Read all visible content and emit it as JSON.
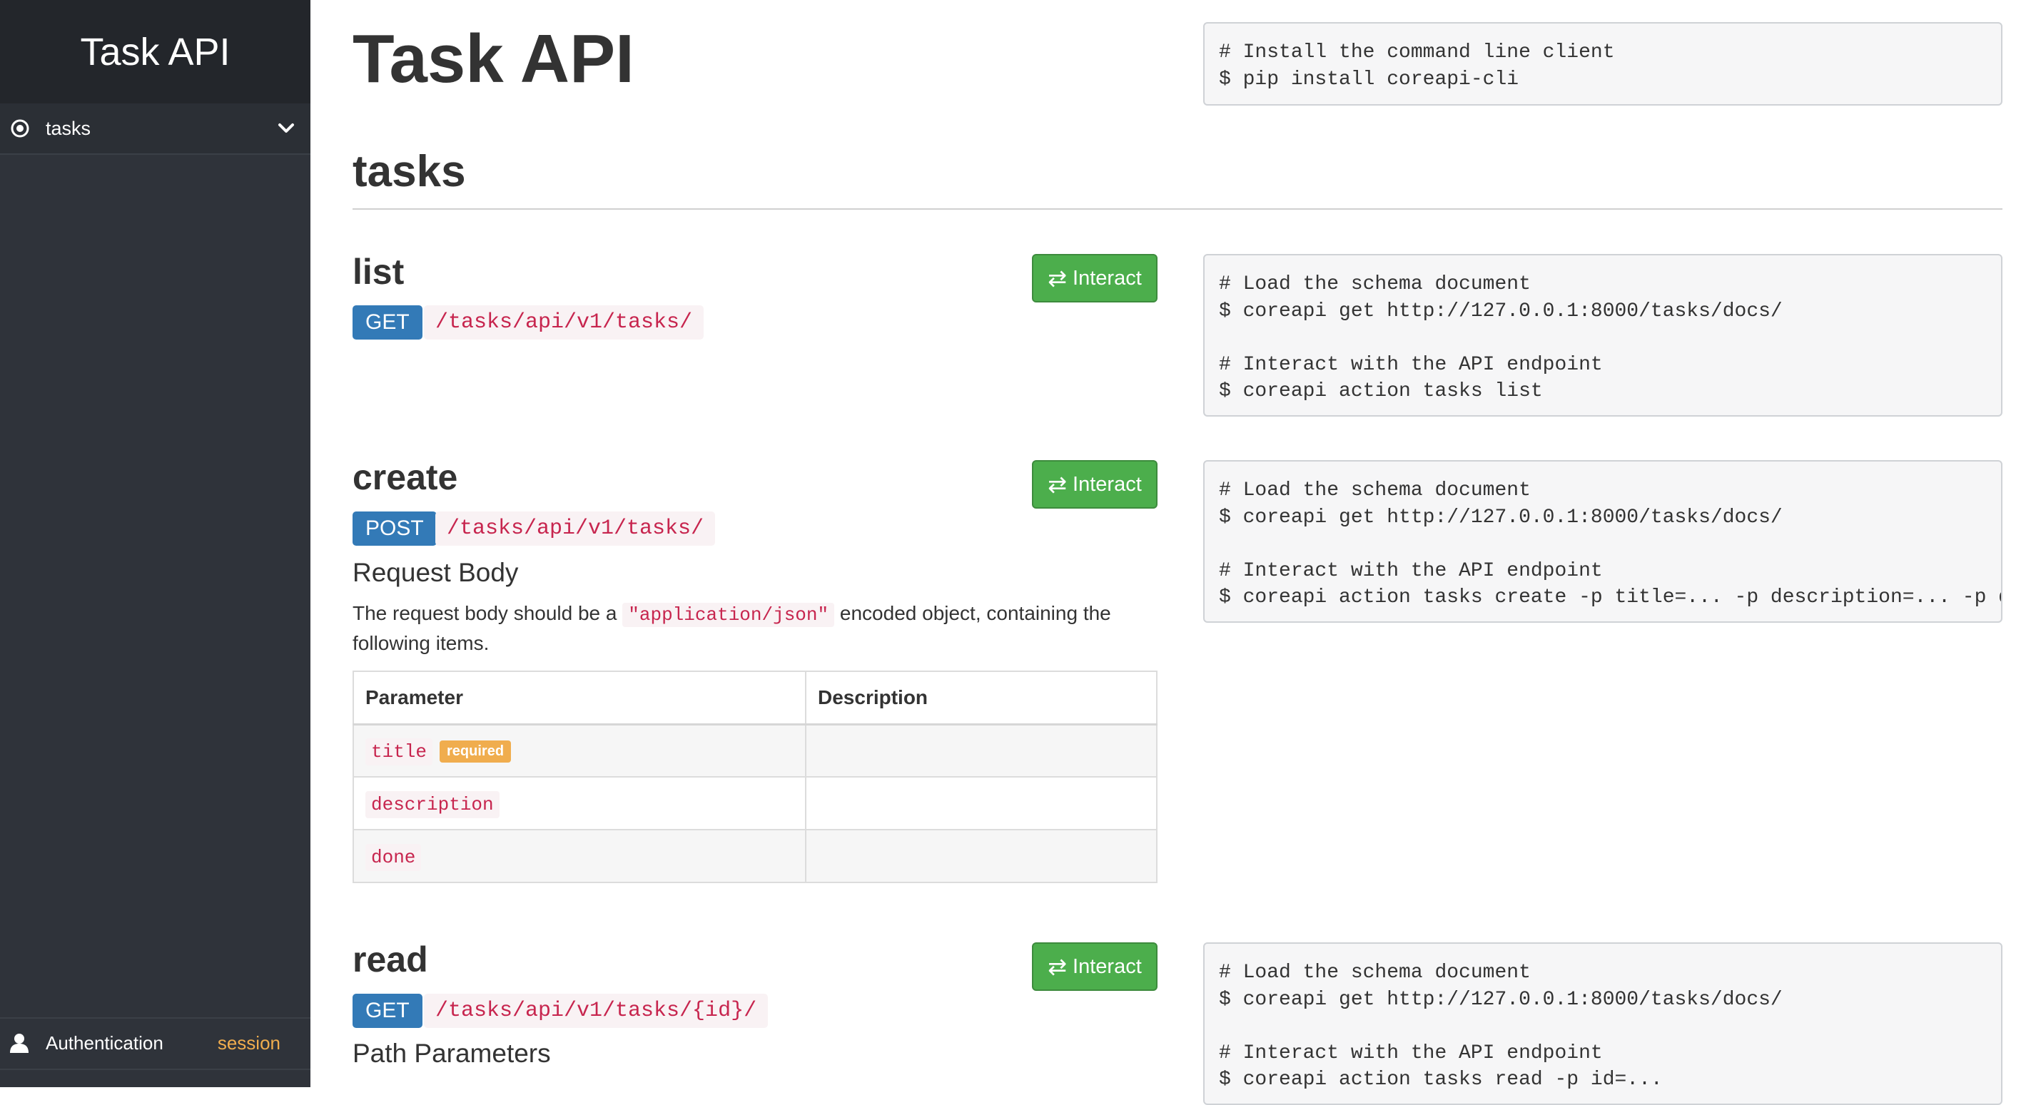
{
  "sidebar": {
    "brand": "Task API",
    "nav_items": [
      {
        "label": "tasks",
        "icon": "target-circle-icon",
        "expand_icon": "chevron-down-icon"
      }
    ],
    "auth": {
      "label": "Authentication",
      "value": "session",
      "icon": "user-icon"
    }
  },
  "header": {
    "title": "Task API",
    "install_code": "# Install the command line client\n$ pip install coreapi-cli"
  },
  "section": {
    "title": "tasks"
  },
  "endpoints": [
    {
      "name": "list",
      "method": "GET",
      "path": "/tasks/api/v1/tasks/",
      "interact_label": "Interact",
      "code": "# Load the schema document\n$ coreapi get http://127.0.0.1:8000/tasks/docs/\n\n# Interact with the API endpoint\n$ coreapi action tasks list"
    },
    {
      "name": "create",
      "method": "POST",
      "path": "/tasks/api/v1/tasks/",
      "interact_label": "Interact",
      "code": "# Load the schema document\n$ coreapi get http://127.0.0.1:8000/tasks/docs/\n\n# Interact with the API endpoint\n$ coreapi action tasks create -p title=... -p description=... -p done=...",
      "body_title": "Request Body",
      "body_desc_pre": "The request body should be a ",
      "body_desc_code": "\"application/json\"",
      "body_desc_post": " encoded object, containing the following items.",
      "table": {
        "headers": [
          "Parameter",
          "Description"
        ],
        "rows": [
          {
            "param": "title",
            "badge": "required",
            "description": ""
          },
          {
            "param": "description",
            "badge": "",
            "description": ""
          },
          {
            "param": "done",
            "badge": "",
            "description": ""
          }
        ]
      }
    },
    {
      "name": "read",
      "method": "GET",
      "path": "/tasks/api/v1/tasks/{id}/",
      "interact_label": "Interact",
      "code": "# Load the schema document\n$ coreapi get http://127.0.0.1:8000/tasks/docs/\n\n# Interact with the API endpoint\n$ coreapi action tasks read -p id=...",
      "params_title": "Path Parameters"
    }
  ],
  "colors": {
    "sidebar_bg": "#2f333a",
    "get_badge": "#337ab7",
    "interact_button": "#4cae4c",
    "required_badge": "#f0ad4e",
    "code_text": "#c7254e"
  }
}
